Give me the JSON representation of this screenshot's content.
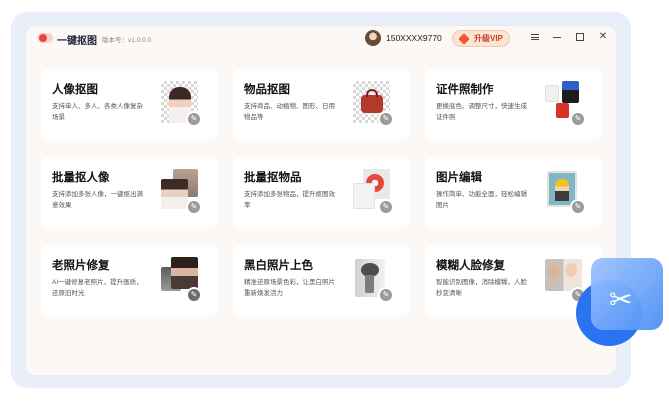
{
  "app": {
    "title": "一键抠图",
    "version": "版本号：v1.0.0.0"
  },
  "user": {
    "phone": "150XXXX9770",
    "avatar_icon": "user-avatar"
  },
  "vip": {
    "label": "升级VIP",
    "icon": "diamond-icon",
    "accent": "#f05a2b"
  },
  "window_controls": [
    "menu-icon",
    "minimize-icon",
    "maximize-icon",
    "close-icon"
  ],
  "cards": [
    {
      "title": "人像抠图",
      "desc": "支持单人、多人、各类人像复杂场景"
    },
    {
      "title": "物品抠图",
      "desc": "支持商品、动植物、图形、日用物品等"
    },
    {
      "title": "证件照制作",
      "desc": "更换底色、调整尺寸，快速生成证件照"
    },
    {
      "title": "批量抠人像",
      "desc": "支持添加多张人像，一键抠出满意效果"
    },
    {
      "title": "批量抠物品",
      "desc": "支持添加多张物品，提升抠图效率"
    },
    {
      "title": "图片编辑",
      "desc": "操作简单、功能全面，轻松编辑图片"
    },
    {
      "title": "老照片修复",
      "desc": "AI一键修复老照片，提升画质，还原旧时光"
    },
    {
      "title": "黑白照片上色",
      "desc": "精准还原场景色彩，让黑白照片重新焕发活力"
    },
    {
      "title": "模糊人脸修复",
      "desc": "智能识别图像，消除模糊，人脸秒变清晰"
    }
  ]
}
